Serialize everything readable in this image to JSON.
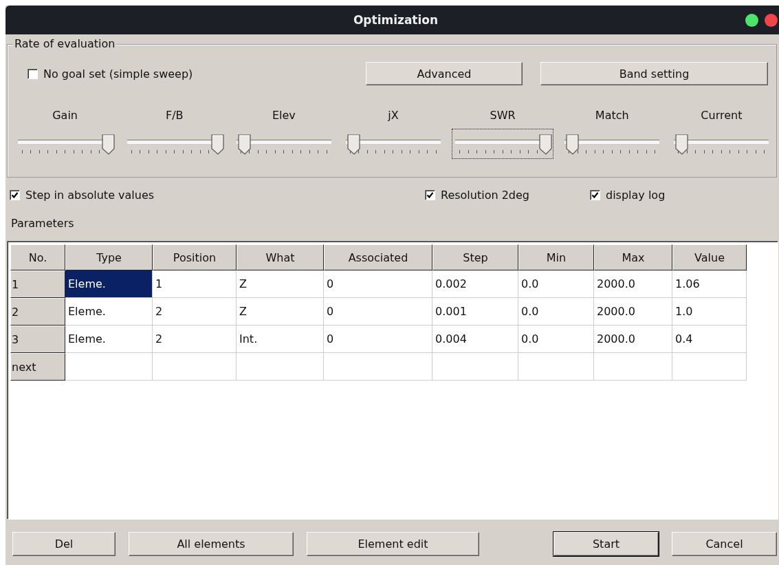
{
  "window": {
    "title": "Optimization"
  },
  "rate_group": {
    "title": "Rate of evaluation",
    "no_goal": {
      "label": "No goal set (simple sweep)",
      "checked": false
    },
    "buttons": [
      {
        "label": "Advanced"
      },
      {
        "label": "Band setting"
      }
    ],
    "sliders": [
      {
        "label": "Gain",
        "level": 1,
        "focused": false
      },
      {
        "label": "F/B",
        "level": 1,
        "focused": false
      },
      {
        "label": "Elev",
        "level": 0,
        "focused": false
      },
      {
        "label": "jX",
        "level": 0,
        "focused": false
      },
      {
        "label": "SWR",
        "level": 1,
        "focused": true
      },
      {
        "label": "Match",
        "level": 0,
        "focused": false
      },
      {
        "label": "Current",
        "level": 0,
        "focused": false
      }
    ]
  },
  "options": [
    {
      "label": "Step in absolute values",
      "checked": true
    },
    {
      "label": "Resolution 2deg",
      "checked": true
    },
    {
      "label": "display log",
      "checked": true
    }
  ],
  "parameters_label": "Parameters",
  "table": {
    "columns": [
      "No.",
      "Type",
      "Position",
      "What",
      "Associated",
      "Step",
      "Min",
      "Max",
      "Value"
    ],
    "rows": [
      {
        "no": "1",
        "cells": [
          {
            "text": "Eleme.",
            "selected": true
          },
          {
            "text": "1",
            "selected": false
          },
          {
            "text": "Z",
            "selected": false
          },
          {
            "text": "0",
            "selected": false
          },
          {
            "text": "0.002",
            "selected": false
          },
          {
            "text": "0.0",
            "selected": false
          },
          {
            "text": "2000.0",
            "selected": false
          },
          {
            "text": "1.06",
            "selected": false
          }
        ]
      },
      {
        "no": "2",
        "cells": [
          {
            "text": "Eleme.",
            "selected": false
          },
          {
            "text": "2",
            "selected": false
          },
          {
            "text": "Z",
            "selected": false
          },
          {
            "text": "0",
            "selected": false
          },
          {
            "text": "0.001",
            "selected": false
          },
          {
            "text": "0.0",
            "selected": false
          },
          {
            "text": "2000.0",
            "selected": false
          },
          {
            "text": "1.0",
            "selected": false
          }
        ]
      },
      {
        "no": "3",
        "cells": [
          {
            "text": "Eleme.",
            "selected": false
          },
          {
            "text": "2",
            "selected": false
          },
          {
            "text": "Int.",
            "selected": false
          },
          {
            "text": "0",
            "selected": false
          },
          {
            "text": "0.004",
            "selected": false
          },
          {
            "text": "0.0",
            "selected": false
          },
          {
            "text": "2000.0",
            "selected": false
          },
          {
            "text": "0.4",
            "selected": false
          }
        ]
      },
      {
        "no": "next"
      }
    ]
  },
  "bottom_buttons": [
    {
      "label": "Del",
      "default": false
    },
    {
      "label": "All elements",
      "default": false
    },
    {
      "label": "Element edit",
      "default": false
    },
    {
      "label": "Start",
      "default": true
    },
    {
      "label": "Cancel",
      "default": false
    }
  ]
}
